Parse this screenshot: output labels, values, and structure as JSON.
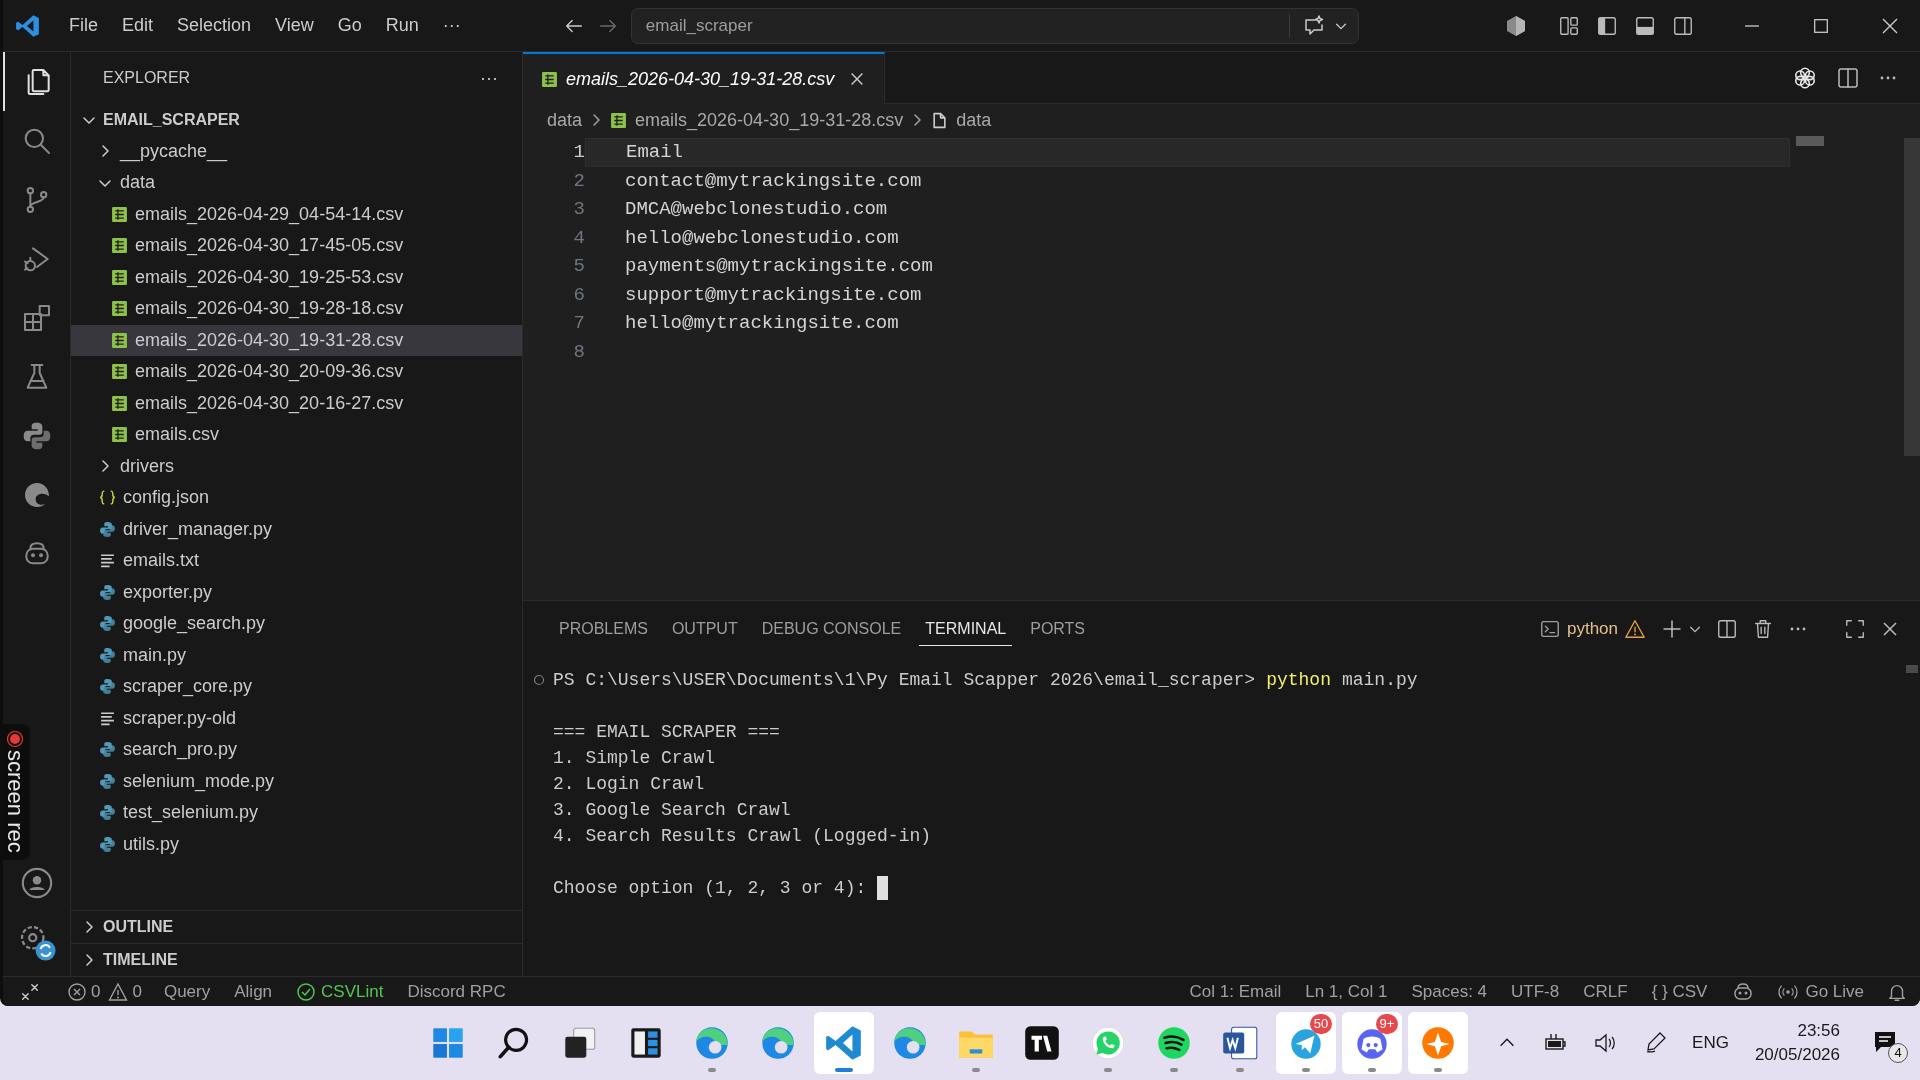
{
  "title_bar": {
    "menu": [
      "File",
      "Edit",
      "Selection",
      "View",
      "Go",
      "Run",
      "···"
    ],
    "search": "email_scraper"
  },
  "activity_bar": [
    {
      "kind": "explorer",
      "selected": true
    },
    {
      "kind": "search",
      "selected": false
    },
    {
      "kind": "source-control",
      "selected": false
    },
    {
      "kind": "run",
      "selected": false
    },
    {
      "kind": "extensions",
      "selected": false
    },
    {
      "kind": "testing",
      "selected": false
    },
    {
      "kind": "python",
      "selected": false
    },
    {
      "kind": "browser",
      "selected": false
    },
    {
      "kind": "robot",
      "selected": false
    }
  ],
  "recorder": {
    "label": "screen rec"
  },
  "sidebar": {
    "title": "EXPLORER",
    "more": "···",
    "root": {
      "label": "EMAIL_SCRAPER",
      "expanded": true,
      "children": [
        {
          "label": "__pycache__",
          "kind": "folder",
          "expanded": false,
          "selected": false
        },
        {
          "label": "data",
          "kind": "folder",
          "expanded": true,
          "selected": false,
          "children": [
            {
              "label": "emails_2026-04-29_04-54-14.csv",
              "kind": "csv",
              "selected": false
            },
            {
              "label": "emails_2026-04-30_17-45-05.csv",
              "kind": "csv",
              "selected": false
            },
            {
              "label": "emails_2026-04-30_19-25-53.csv",
              "kind": "csv",
              "selected": false
            },
            {
              "label": "emails_2026-04-30_19-28-18.csv",
              "kind": "csv",
              "selected": false
            },
            {
              "label": "emails_2026-04-30_19-31-28.csv",
              "kind": "csv",
              "selected": true
            },
            {
              "label": "emails_2026-04-30_20-09-36.csv",
              "kind": "csv",
              "selected": false
            },
            {
              "label": "emails_2026-04-30_20-16-27.csv",
              "kind": "csv",
              "selected": false
            },
            {
              "label": "emails.csv",
              "kind": "csv",
              "selected": false
            }
          ]
        },
        {
          "label": "drivers",
          "kind": "folder",
          "expanded": false,
          "selected": false
        },
        {
          "label": "config.json",
          "kind": "json",
          "selected": false
        },
        {
          "label": "driver_manager.py",
          "kind": "python",
          "selected": false
        },
        {
          "label": "emails.txt",
          "kind": "text",
          "selected": false
        },
        {
          "label": "exporter.py",
          "kind": "python",
          "selected": false
        },
        {
          "label": "google_search.py",
          "kind": "python",
          "selected": false
        },
        {
          "label": "main.py",
          "kind": "python",
          "selected": false
        },
        {
          "label": "scraper_core.py",
          "kind": "python",
          "selected": false
        },
        {
          "label": "scraper.py-old",
          "kind": "text",
          "selected": false
        },
        {
          "label": "search_pro.py",
          "kind": "python",
          "selected": false
        },
        {
          "label": "selenium_mode.py",
          "kind": "python",
          "selected": false
        },
        {
          "label": "test_selenium.py",
          "kind": "python",
          "selected": false
        },
        {
          "label": "utils.py",
          "kind": "python",
          "selected": false
        }
      ]
    },
    "sections": [
      {
        "label": "OUTLINE",
        "expanded": false
      },
      {
        "label": "TIMELINE",
        "expanded": false
      }
    ]
  },
  "editor": {
    "tab": {
      "label": "emails_2026-04-30_19-31-28.csv",
      "preview": true
    },
    "breadcrumbs": [
      {
        "label": "data",
        "kind": "folder"
      },
      {
        "label": "emails_2026-04-30_19-31-28.csv",
        "kind": "csv"
      },
      {
        "label": "data",
        "kind": "symbol"
      }
    ],
    "lines": [
      {
        "number": "1",
        "text": "Email",
        "current": true
      },
      {
        "number": "2",
        "text": "contact@mytrackingsite.com",
        "current": false
      },
      {
        "number": "3",
        "text": "DMCA@webclonestudio.com",
        "current": false
      },
      {
        "number": "4",
        "text": "hello@webclonestudio.com",
        "current": false
      },
      {
        "number": "5",
        "text": "payments@mytrackingsite.com",
        "current": false
      },
      {
        "number": "6",
        "text": "support@mytrackingsite.com",
        "current": false
      },
      {
        "number": "7",
        "text": "hello@mytrackingsite.com",
        "current": false
      },
      {
        "number": "8",
        "current": false
      }
    ]
  },
  "panel": {
    "tabs": [
      {
        "label": "PROBLEMS",
        "selected": false
      },
      {
        "label": "OUTPUT",
        "selected": false
      },
      {
        "label": "DEBUG CONSOLE",
        "selected": false
      },
      {
        "label": "TERMINAL",
        "selected": true
      },
      {
        "label": "PORTS",
        "selected": false
      }
    ],
    "shell": "python",
    "terminal": [
      {
        "kind": "prompt",
        "prompt": "PS C:\\Users\\USER\\Documents\\1\\Py Email Scapper 2026\\email_scraper>",
        "command": "python",
        "args": "main.py"
      },
      {
        "kind": "blank"
      },
      {
        "kind": "output",
        "text": "=== EMAIL SCRAPER ==="
      },
      {
        "kind": "output",
        "text": "1. Simple Crawl"
      },
      {
        "kind": "output",
        "text": "2. Login Crawl"
      },
      {
        "kind": "output",
        "text": "3. Google Search Crawl"
      },
      {
        "kind": "output",
        "text": "4. Search Results Crawl (Logged-in)"
      },
      {
        "kind": "blank"
      },
      {
        "kind": "input",
        "text": "Choose option (1, 2, 3 or 4):",
        "cursor": true
      }
    ]
  },
  "status_bar": {
    "left": [
      {
        "kind": "remote"
      },
      {
        "kind": "problems",
        "errors": "0",
        "warnings": "0"
      },
      {
        "kind": "text",
        "text": "Query"
      },
      {
        "kind": "text",
        "text": "Align"
      },
      {
        "kind": "ok",
        "text": "CSVLint"
      },
      {
        "kind": "text",
        "text": "Discord RPC"
      }
    ],
    "right": [
      {
        "kind": "text",
        "text": "Col 1: Email"
      },
      {
        "kind": "text",
        "text": "Ln 1, Col 1"
      },
      {
        "kind": "text",
        "text": "Spaces: 4"
      },
      {
        "kind": "text",
        "text": "UTF-8"
      },
      {
        "kind": "text",
        "text": "CRLF"
      },
      {
        "kind": "text",
        "text": "{ } CSV"
      },
      {
        "kind": "robot"
      },
      {
        "kind": "live",
        "text": "Go Live"
      },
      {
        "kind": "bell"
      }
    ]
  },
  "taskbar": {
    "apps": [
      {
        "kind": "start",
        "running": false,
        "active": false,
        "highlighted": false
      },
      {
        "kind": "search",
        "running": false,
        "active": false,
        "highlighted": false
      },
      {
        "kind": "taskview",
        "running": false,
        "active": false,
        "highlighted": false
      },
      {
        "kind": "widgets",
        "running": false,
        "active": false,
        "highlighted": false
      },
      {
        "kind": "browser",
        "running": true,
        "active": false,
        "highlighted": false
      },
      {
        "kind": "browser",
        "running": false,
        "active": false,
        "highlighted": false
      },
      {
        "kind": "vscode",
        "running": true,
        "active": true,
        "highlighted": true
      },
      {
        "kind": "browser",
        "running": false,
        "active": false,
        "highlighted": false
      },
      {
        "kind": "folder",
        "running": true,
        "active": false,
        "highlighted": false
      },
      {
        "kind": "chart",
        "running": false,
        "active": false,
        "highlighted": false
      },
      {
        "kind": "chat",
        "running": true,
        "active": false,
        "highlighted": false
      },
      {
        "kind": "music",
        "running": true,
        "active": false,
        "highlighted": false
      },
      {
        "kind": "word",
        "running": true,
        "active": false,
        "highlighted": false
      },
      {
        "kind": "messenger",
        "running": true,
        "active": false,
        "highlighted": true,
        "badge": "50"
      },
      {
        "kind": "discord",
        "running": true,
        "active": false,
        "highlighted": true,
        "badge": "9+"
      },
      {
        "kind": "antivirus",
        "running": true,
        "active": false,
        "highlighted": true
      }
    ],
    "language": "ENG",
    "time": "23:56",
    "date": "20/05/2026",
    "notifications": "4"
  }
}
